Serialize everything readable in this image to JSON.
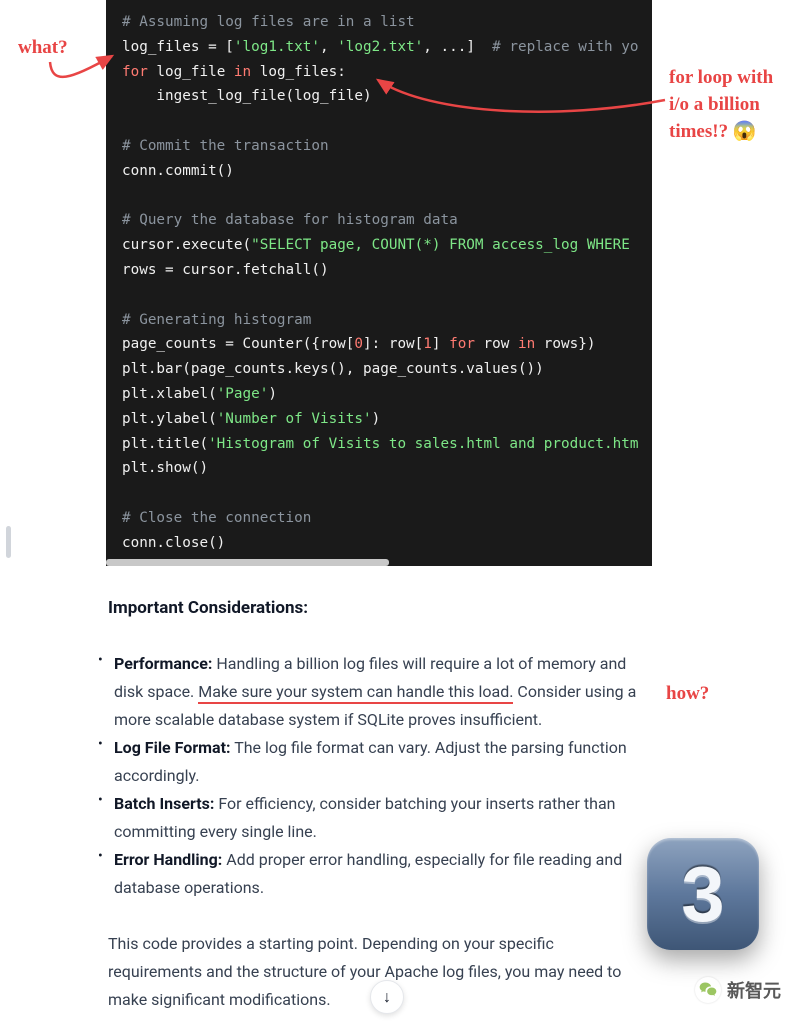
{
  "code": {
    "l1": "# Assuming log files are in a list",
    "l2a": "log_files = [",
    "l2b": "'log1.txt'",
    "l2c": ", ",
    "l2d": "'log2.txt'",
    "l2e": ", ...]  ",
    "l2f": "# replace with yo",
    "l3a": "for",
    "l3b": " log_file ",
    "l3c": "in",
    "l3d": " log_files:",
    "l4": "    ingest_log_file(log_file)",
    "l5": "",
    "l6": "# Commit the transaction",
    "l7": "conn.commit()",
    "l8": "",
    "l9": "# Query the database for histogram data",
    "l10a": "cursor.execute(",
    "l10b": "\"SELECT page, COUNT(*) FROM access_log WHERE ",
    "l11": "rows = cursor.fetchall()",
    "l12": "",
    "l13": "# Generating histogram",
    "l14a": "page_counts = Counter({row[",
    "l14n0": "0",
    "l14b": "]: row[",
    "l14n1": "1",
    "l14c": "] ",
    "l14for": "for",
    "l14d": " row ",
    "l14in": "in",
    "l14e": " rows})",
    "l15": "plt.bar(page_counts.keys(), page_counts.values())",
    "l16a": "plt.xlabel(",
    "l16b": "'Page'",
    "l16c": ")",
    "l17a": "plt.ylabel(",
    "l17b": "'Number of Visits'",
    "l17c": ")",
    "l18a": "plt.title(",
    "l18b": "'Histogram of Visits to sales.html and product.htm",
    "l19": "plt.show()",
    "l20": "",
    "l21": "# Close the connection",
    "l22": "conn.close()"
  },
  "article": {
    "heading": "Important Considerations:",
    "items": [
      {
        "bold": "Performance:",
        "pre": " Handling a billion log files will require a lot of memory and disk space. ",
        "underlined": "Make sure your system can handle this load.",
        "post": " Consider using a more scalable database system if SQLite proves insufficient."
      },
      {
        "bold": "Log File Format:",
        "pre": " The log file format can vary. Adjust the parsing function accordingly.",
        "underlined": "",
        "post": ""
      },
      {
        "bold": "Batch Inserts:",
        "pre": " For efficiency, consider batching your inserts rather than committing every single line.",
        "underlined": "",
        "post": ""
      },
      {
        "bold": "Error Handling:",
        "pre": " Add proper error handling, especially for file reading and database operations.",
        "underlined": "",
        "post": ""
      }
    ],
    "closing": "This code provides a starting point. Depending on your specific requirements and the structure of your Apache log files, you may need to make significant modifications."
  },
  "annotations": {
    "what": "what?",
    "forloop": "for loop with i/o a billion times!? ",
    "emoji": "😱",
    "how": "how?"
  },
  "badge": {
    "number": "3"
  },
  "watermark": {
    "text": "新智元"
  },
  "scroll_down": {
    "glyph": "↓"
  }
}
